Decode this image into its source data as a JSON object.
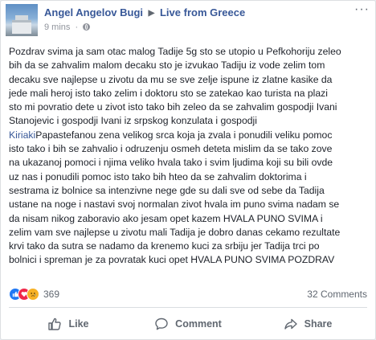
{
  "post": {
    "author": "Angel Angelov Bugi",
    "separator": "▶",
    "group": "Live from Greece",
    "time": "9 mins",
    "dot": "·",
    "more": "···",
    "body_lines": [
      "Pozdrav svima ja sam otac malog Tadije 5g sto se utopio u Pefkohoriju zeleo",
      "bih da se zahvalim malom decaku sto je izvukao Tadiju iz vode zelim tom",
      "decaku sve najlepse u zivotu da mu se sve zelje ispune iz zlatne kasike da",
      "jede mali heroj isto tako zelim i doktoru sto se zatekao kao turista na plazi",
      "sto mi povratio dete u zivot isto tako bih zeleo da se zahvalim gospodji Ivani",
      "Stanojevic i gospodji Ivani iz srpskog konzulata i gospodji"
    ],
    "mention": "Kiriaki",
    "mention_rest": "Papastefanou zena velikog srca koja ja zvala i ponudili veliku pomoc",
    "body_lines_2": [
      "isto tako i bih se zahvalio i odruzenju osmeh deteta mislim da se tako zove",
      "na ukazanoj pomoci i njima veliko hvala tako i svim ljudima koji su bili ovde",
      "uz nas i ponudili pomoc isto tako bih hteo da se zahvalim doktorima i",
      "sestrama iz bolnice sa intenzivne nege gde su dali sve od sebe da Tadija",
      "ustane na noge i nastavi svoj normalan zivot hvala im puno svima nadam se",
      "da nisam nikog zaboravio ako jesam opet kazem HVALA PUNO SVIMA i",
      "zelim vam sve najlepse u zivotu mali Tadija je dobro danas cekamo rezultate",
      "krvi tako da sutra se nadamo da krenemo kuci za srbiju jer Tadija trci po",
      "bolnici i spreman je za povratak kuci opet HVALA PUNO SVIMA POZDRAV"
    ],
    "reactions": {
      "count": "369",
      "comments": "32 Comments"
    },
    "actions": {
      "like": "Like",
      "comment": "Comment",
      "share": "Share"
    }
  },
  "colors": {
    "link": "#385898",
    "like_blue": "#2078f4",
    "love_red": "#f0284a",
    "sad_yellow": "#f7b125"
  }
}
